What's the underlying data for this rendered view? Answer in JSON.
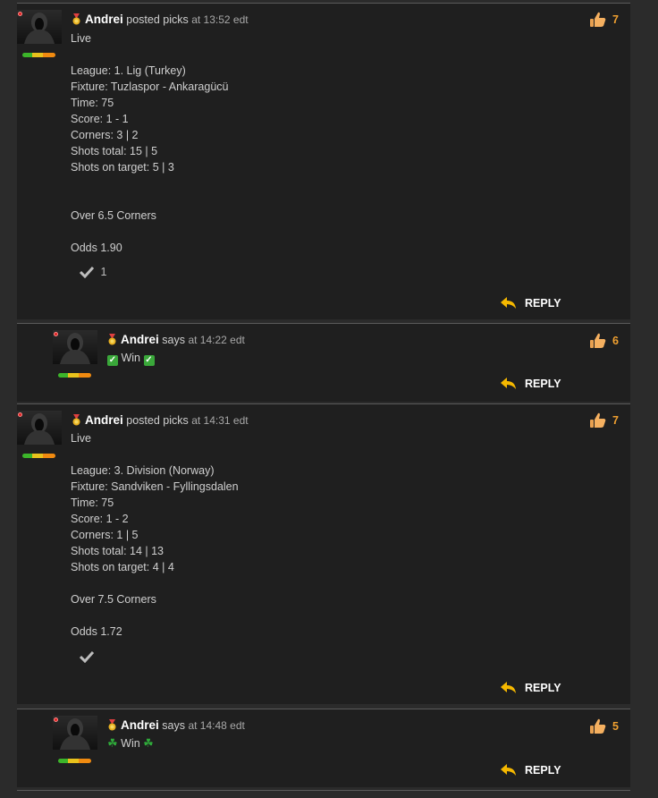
{
  "posts": [
    {
      "author": "Andrei",
      "verb": "posted picks",
      "time": "at 13:52 edt",
      "likes": "7",
      "text": "Live\n\nLeague: 1. Lig (Turkey)\nFixture: Tuzlaspor - Ankaragücü\nTime: 75\nScore: 1 - 1\nCorners: 3 | 2\nShots total: 15 | 5\nShots on target: 5 | 3\n\n\nOver 6.5 Corners\n\nOdds 1.90",
      "checks": "1",
      "reply_label": "REPLY"
    },
    {
      "author": "Andrei",
      "verb": "says",
      "time": "at 14:22 edt",
      "likes": "6",
      "text": "Win",
      "reply_label": "REPLY"
    },
    {
      "author": "Andrei",
      "verb": "posted picks",
      "time": "at 14:31 edt",
      "likes": "7",
      "text": "Live\n\nLeague: 3. Division (Norway)\nFixture: Sandviken - Fyllingsdalen\nTime: 75\nScore: 1 - 2\nCorners: 1 | 5\nShots total: 14 | 13\nShots on target: 4 | 4\n\nOver 7.5 Corners\n\nOdds 1.72",
      "reply_label": "REPLY"
    },
    {
      "author": "Andrei",
      "verb": "says",
      "time": "at 14:48 edt",
      "likes": "5",
      "text": "Win",
      "reply_label": "REPLY"
    }
  ],
  "colors": {
    "background": "#2b2b2b",
    "card": "#1f1f1f",
    "like_count": "#f0a030",
    "reply_arrow": "#f5b800"
  },
  "icons": {
    "avatar": "hooded-figure-avatar",
    "badge": "medal-icon",
    "like": "thumbs-up-icon",
    "reply": "reply-arrow-icon",
    "vote": "checkmark-icon",
    "win_marks_post2": "check-mark-emoji",
    "win_marks_post4": "four-leaf-clover-emoji"
  }
}
